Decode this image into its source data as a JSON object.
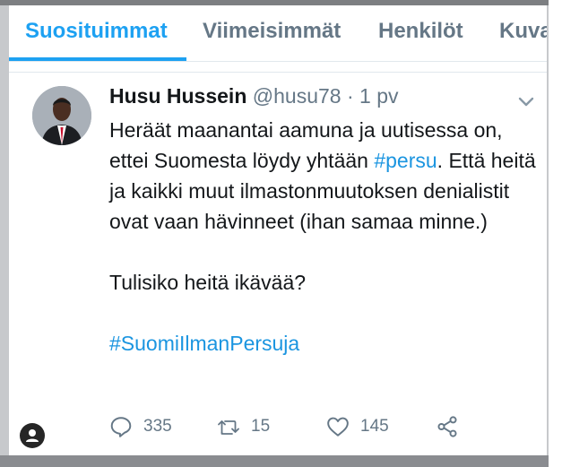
{
  "tabs": [
    {
      "label": "Suosituimmat",
      "active": true
    },
    {
      "label": "Viimeisimmät",
      "active": false
    },
    {
      "label": "Henkilöt",
      "active": false
    },
    {
      "label": "Kuva",
      "active": false
    }
  ],
  "tweet": {
    "author_name": "Husu Hussein",
    "handle": "@husu78",
    "separator": "·",
    "time": "1 pv",
    "text_part1": "Heräät maanantai aamuna ja uutisessa on, ettei Suomesta löydy yhtään ",
    "hashtag1": "#persu",
    "text_part2": ". Että heitä ja kaikki muut ilmastonmuutoksen denialistit ovat vaan hävinneet (ihan samaa minne.)",
    "paragraph2": "Tulisiko heitä ikävää?",
    "hashtag2": "#SuomiIlmanPersuja"
  },
  "actions": {
    "reply_count": "335",
    "retweet_count": "15",
    "like_count": "145"
  },
  "colors": {
    "accent": "#1da1f2",
    "hashtag": "#1b95e0",
    "muted": "#657786",
    "text": "#14171a"
  },
  "icons": [
    "reply-icon",
    "retweet-icon",
    "like-icon",
    "share-icon",
    "chevron-down-icon",
    "profile-icon"
  ]
}
